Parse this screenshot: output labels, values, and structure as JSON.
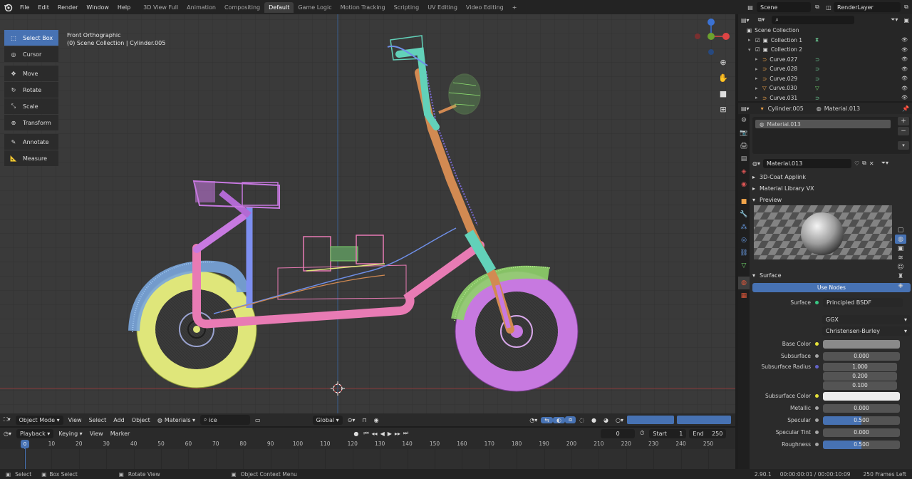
{
  "menu": [
    "File",
    "Edit",
    "Render",
    "Window",
    "Help"
  ],
  "workspaces": [
    {
      "label": "3D View Full",
      "active": false
    },
    {
      "label": "Animation",
      "active": false
    },
    {
      "label": "Compositing",
      "active": false
    },
    {
      "label": "Default",
      "active": true
    },
    {
      "label": "Game Logic",
      "active": false
    },
    {
      "label": "Motion Tracking",
      "active": false
    },
    {
      "label": "Scripting",
      "active": false
    },
    {
      "label": "UV Editing",
      "active": false
    },
    {
      "label": "Video Editing",
      "active": false
    }
  ],
  "scene": "Scene",
  "render_layer": "RenderLayer",
  "viewport": {
    "view_name": "Front Orthographic",
    "collection_path": "(0) Scene Collection | Cylinder.005"
  },
  "tools": [
    {
      "label": "Select Box",
      "icon": "select-box-icon",
      "active": true
    },
    {
      "label": "Cursor",
      "icon": "cursor-icon",
      "active": false
    },
    {
      "label": "Move",
      "icon": "move-icon",
      "active": false
    },
    {
      "label": "Rotate",
      "icon": "rotate-icon",
      "active": false
    },
    {
      "label": "Scale",
      "icon": "scale-icon",
      "active": false
    },
    {
      "label": "Transform",
      "icon": "transform-icon",
      "active": false
    },
    {
      "label": "Annotate",
      "icon": "annotate-icon",
      "active": false
    },
    {
      "label": "Measure",
      "icon": "measure-icon",
      "active": false
    }
  ],
  "vp_header": {
    "mode": "Object Mode",
    "view": "View",
    "select": "Select",
    "add": "Add",
    "object": "Object",
    "materials": "Materials",
    "search": "ice",
    "transform_orientation": "Global"
  },
  "timeline": {
    "playback": "Playback",
    "keying": "Keying",
    "view": "View",
    "marker": "Marker",
    "current_frame": "0",
    "start_label": "Start",
    "start": "1",
    "end_label": "End",
    "end": "250",
    "ticks": [
      "0",
      "10",
      "20",
      "30",
      "40",
      "50",
      "60",
      "70",
      "80",
      "90",
      "100",
      "110",
      "120",
      "130",
      "140",
      "150",
      "160",
      "170",
      "180",
      "190",
      "200",
      "210",
      "220",
      "230",
      "240",
      "250"
    ]
  },
  "status": {
    "select": "Select",
    "box_select": "Box Select",
    "rotate_view": "Rotate View",
    "context_menu": "Object Context Menu",
    "version": "2.90.1",
    "time": "00:00:00:01 / 00:00:10:09",
    "frames_left": "250 Frames Left"
  },
  "outliner": {
    "root": "Scene Collection",
    "rows": [
      {
        "label": "Collection 1",
        "indent": 1
      },
      {
        "label": "Collection 2",
        "indent": 1
      },
      {
        "label": "Curve.027",
        "indent": 2
      },
      {
        "label": "Curve.028",
        "indent": 2
      },
      {
        "label": "Curve.029",
        "indent": 2
      },
      {
        "label": "Curve.030",
        "indent": 2
      },
      {
        "label": "Curve.031",
        "indent": 2
      }
    ]
  },
  "properties": {
    "object": "Cylinder.005",
    "material": "Material.013",
    "slot": "Material.013",
    "material_field": "Material.013",
    "panels": [
      "3D-Coat Applink",
      "Material Library VX",
      "Preview"
    ],
    "surface_panel": "Surface",
    "use_nodes": "Use Nodes",
    "surface_label": "Surface",
    "surface_value": "Principled BSDF",
    "distribution": "GGX",
    "subsurface_method": "Christensen-Burley",
    "fields": [
      {
        "label": "Base Color",
        "type": "color",
        "color": "#8a8a8a",
        "dot": "#e6e23a"
      },
      {
        "label": "Subsurface",
        "type": "num",
        "value": "0.000",
        "dot": "#a6a6a6"
      },
      {
        "label": "Subsurface Radius",
        "type": "vec",
        "values": [
          "1.000",
          "0.200",
          "0.100"
        ],
        "dot": "#6363c7"
      },
      {
        "label": "Subsurface Color",
        "type": "color",
        "color": "#ececec",
        "dot": "#e6e23a"
      },
      {
        "label": "Metallic",
        "type": "num",
        "value": "0.000",
        "dot": "#a6a6a6"
      },
      {
        "label": "Specular",
        "type": "bar",
        "value": "0.500",
        "fill": 0.5,
        "dot": "#a6a6a6"
      },
      {
        "label": "Specular Tint",
        "type": "num",
        "value": "0.000",
        "dot": "#a6a6a6"
      },
      {
        "label": "Roughness",
        "type": "bar",
        "value": "0.500",
        "fill": 0.5,
        "dot": "#a6a6a6"
      }
    ]
  },
  "colors": {
    "accent": "#4772b3",
    "pink": "#e87bb4",
    "purple": "#c779e0",
    "yellow": "#dfe67a",
    "blue_wire": "#6f8fe8",
    "green": "#7bd36a",
    "orange": "#d28a52",
    "teal": "#62d1b9"
  }
}
